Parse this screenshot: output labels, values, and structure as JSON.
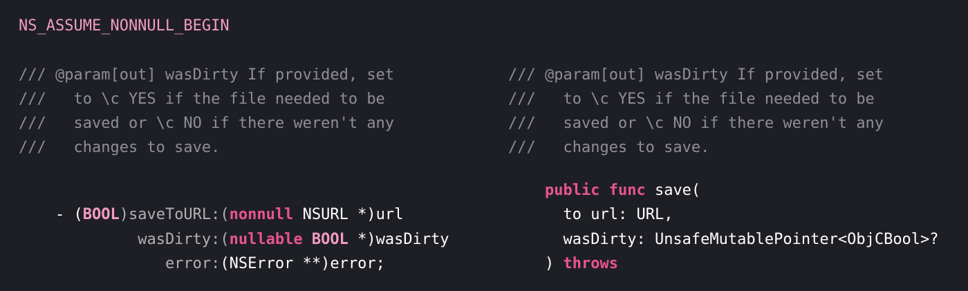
{
  "objc": {
    "header_macro": "NS_ASSUME_NONNULL_BEGIN",
    "doc_lines": [
      "/// @param[out] wasDirty If provided, set",
      "///   to \\c YES if the file needed to be",
      "///   saved or \\c NO if there weren't any",
      "///   changes to save."
    ],
    "decl": {
      "l1": {
        "dash": "- (",
        "bool": "BOOL",
        "sel": ")saveToURL:(",
        "nonnull": "nonnull",
        "rest": " NSURL *)url"
      },
      "l2": {
        "indent": "         ",
        "sel": "wasDirty:(",
        "nullable": "nullable",
        "space": " ",
        "bool": "BOOL",
        "rest": " *)wasDirty"
      },
      "l3": {
        "indent": "            ",
        "sel": "error:",
        "rest": "(NSError **)error;"
      }
    }
  },
  "swift": {
    "doc_lines": [
      "/// @param[out] wasDirty If provided, set",
      "///   to \\c YES if the file needed to be",
      "///   saved or \\c NO if there weren't any",
      "///   changes to save."
    ],
    "decl": {
      "l1": {
        "kw1": "public",
        "space": " ",
        "kw2": "func",
        "rest": " save("
      },
      "l2": {
        "indent": "  ",
        "label": "to url",
        "rest": ": URL,"
      },
      "l3": {
        "indent": "  ",
        "label": "wasDirty",
        "rest": ": UnsafeMutablePointer<ObjCBool>?"
      },
      "l4": {
        "paren": ") ",
        "kw": "throws"
      }
    }
  }
}
